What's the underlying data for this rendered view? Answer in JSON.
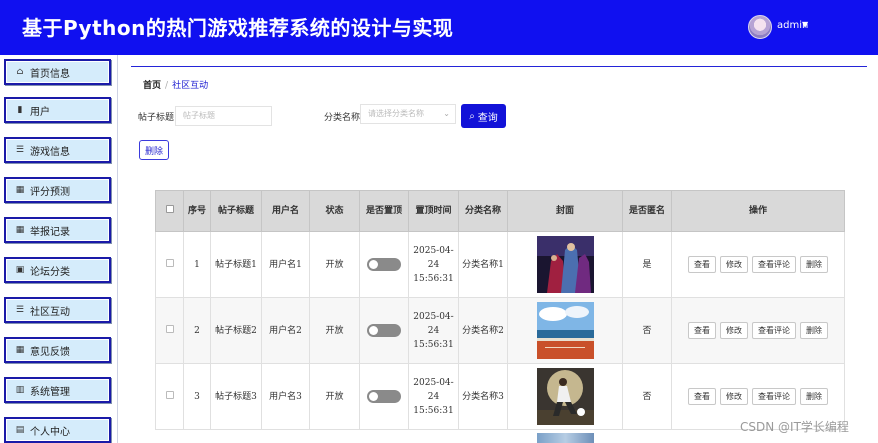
{
  "app": {
    "title": "基于Python的热门游戏推荐系统的设计与实现",
    "username": "admin"
  },
  "sidebar": {
    "items": [
      {
        "label": "首页信息",
        "icon": "home-icon"
      },
      {
        "label": "用户",
        "icon": "doc-icon"
      },
      {
        "label": "游戏信息",
        "icon": "menu-icon"
      },
      {
        "label": "评分预测",
        "icon": "grid-icon"
      },
      {
        "label": "举报记录",
        "icon": "grid-icon"
      },
      {
        "label": "论坛分类",
        "icon": "clipboard-icon"
      },
      {
        "label": "社区互动",
        "icon": "menu-icon"
      },
      {
        "label": "意见反馈",
        "icon": "grid-icon"
      },
      {
        "label": "系统管理",
        "icon": "bar-chart-icon"
      },
      {
        "label": "个人中心",
        "icon": "id-card-icon"
      }
    ]
  },
  "breadcrumb": {
    "home": "首页",
    "separator": "/",
    "current": "社区互动"
  },
  "filters": {
    "title_label": "帖子标题",
    "title_placeholder": "帖子标题",
    "category_label": "分类名称",
    "category_placeholder": "请选择分类名称",
    "query_button": "查询",
    "delete_button": "删除"
  },
  "table": {
    "headers": [
      "",
      "序号",
      "帖子标题",
      "用户名",
      "状态",
      "是否置顶",
      "置顶时间",
      "分类名称",
      "封面",
      "是否匿名",
      "操作"
    ],
    "action_labels": [
      "查看",
      "修改",
      "查看评论",
      "删除"
    ],
    "rows": [
      {
        "index": "1",
        "title": "帖子标题1",
        "username": "用户名1",
        "status": "开放",
        "pin_time_date": "2025-04-24",
        "pin_time_clock": "15:56:31",
        "category": "分类名称1",
        "anonymous": "是"
      },
      {
        "index": "2",
        "title": "帖子标题2",
        "username": "用户名2",
        "status": "开放",
        "pin_time_date": "2025-04-24",
        "pin_time_clock": "15:56:31",
        "category": "分类名称2",
        "anonymous": "否"
      },
      {
        "index": "3",
        "title": "帖子标题3",
        "username": "用户名3",
        "status": "开放",
        "pin_time_date": "2025-04-24",
        "pin_time_clock": "15:56:31",
        "category": "分类名称3",
        "anonymous": "否"
      }
    ]
  },
  "watermark": "CSDN @IT学长编程",
  "colors": {
    "header": "#1010f0",
    "accent": "#1212d8",
    "sidebar_item_bg": "#d5ecfb"
  }
}
